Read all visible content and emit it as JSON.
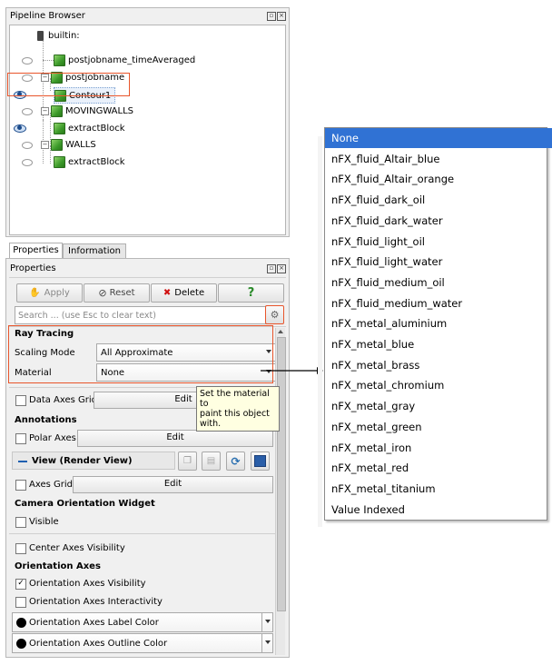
{
  "pipeline": {
    "title": "Pipeline Browser",
    "items": [
      {
        "label": "builtin:"
      },
      {
        "label": "postjobname_timeAveraged"
      },
      {
        "label": "postjobname"
      },
      {
        "label": "Contour1"
      },
      {
        "label": "MOVINGWALLS"
      },
      {
        "label": "extractBlock"
      },
      {
        "label": "WALLS"
      },
      {
        "label": "extractBlock"
      }
    ]
  },
  "tabs": {
    "properties": "Properties",
    "information": "Information"
  },
  "properties": {
    "title": "Properties",
    "apply": "Apply",
    "reset": "Reset",
    "delete": "Delete",
    "help": "?",
    "search_placeholder": "Search ... (use Esc to clear text)",
    "ray_tracing": "Ray Tracing",
    "scaling_mode_label": "Scaling Mode",
    "scaling_mode_value": "All Approximate",
    "material_label": "Material",
    "material_value": "None",
    "data_axes_grid": "Data Axes Grid",
    "edit": "Edit",
    "annotations": "Annotations",
    "polar_axes": "Polar Axes",
    "view_title": "View (Render View)",
    "axes_grid": "Axes Grid",
    "camera_widget": "Camera Orientation Widget",
    "visible": "Visible",
    "center_axes": "Center Axes Visibility",
    "orientation_axes": "Orientation Axes",
    "orientation_visibility": "Orientation Axes Visibility",
    "orientation_interactivity": "Orientation Axes Interactivity",
    "label_color": "Orientation Axes Label Color",
    "outline_color": "Orientation Axes Outline Color"
  },
  "tooltip": {
    "line1": "Set the material to",
    "line2": "paint  this  object",
    "line3": "with."
  },
  "material_menu": [
    "None",
    "nFX_fluid_Altair_blue",
    "nFX_fluid_Altair_orange",
    "nFX_fluid_dark_oil",
    "nFX_fluid_dark_water",
    "nFX_fluid_light_oil",
    "nFX_fluid_light_water",
    "nFX_fluid_medium_oil",
    "nFX_fluid_medium_water",
    "nFX_metal_aluminium",
    "nFX_metal_blue",
    "nFX_metal_brass",
    "nFX_metal_chromium",
    "nFX_metal_gray",
    "nFX_metal_green",
    "nFX_metal_iron",
    "nFX_metal_red",
    "nFX_metal_titanium",
    "Value Indexed"
  ],
  "colors": {
    "highlight": "#e8552b",
    "selection": "#3072d4",
    "tree_icon": "#3c9a2a"
  }
}
